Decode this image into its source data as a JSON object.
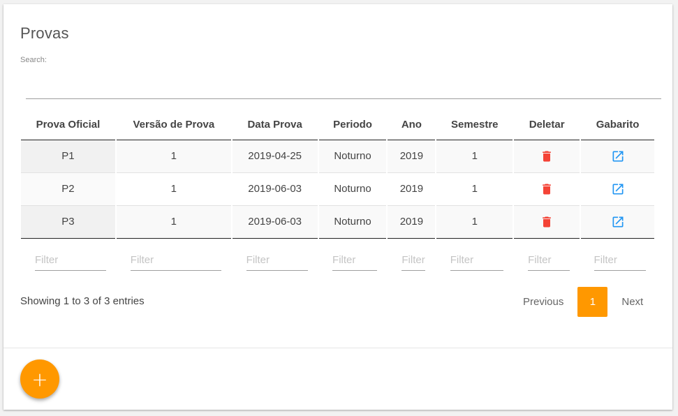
{
  "card": {
    "title": "Provas",
    "search_label": "Search:",
    "search_value": ""
  },
  "table": {
    "columns": [
      "Prova Oficial",
      "Versão de Prova",
      "Data Prova",
      "Periodo",
      "Ano",
      "Semestre",
      "Deletar",
      "Gabarito"
    ],
    "rows": [
      {
        "prova": "P1",
        "versao": "1",
        "data": "2019-04-25",
        "periodo": "Noturno",
        "ano": "2019",
        "semestre": "1"
      },
      {
        "prova": "P2",
        "versao": "1",
        "data": "2019-06-03",
        "periodo": "Noturno",
        "ano": "2019",
        "semestre": "1"
      },
      {
        "prova": "P3",
        "versao": "1",
        "data": "2019-06-03",
        "periodo": "Noturno",
        "ano": "2019",
        "semestre": "1"
      }
    ],
    "filter_placeholder": "Filter",
    "delete_icon": "trash-icon",
    "gabarito_icon": "open-in-new-icon"
  },
  "pagination": {
    "info": "Showing 1 to 3 of 3 entries",
    "previous": "Previous",
    "current": "1",
    "next": "Next"
  },
  "fab": {
    "label": "+",
    "icon": "plus-icon"
  },
  "colors": {
    "accent": "#ff9800",
    "delete": "#f44336",
    "link": "#2196f3"
  }
}
